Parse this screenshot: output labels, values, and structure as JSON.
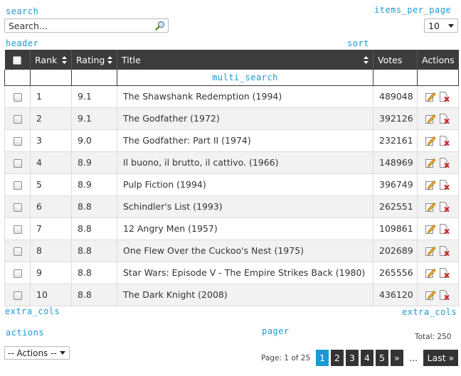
{
  "annotations": {
    "search": "search",
    "items_per_page": "items_per_page",
    "header": "header",
    "sort": "sort",
    "multi_search": "multi_search",
    "extra_cols_left": "extra_cols",
    "extra_cols_right": "extra_cols",
    "actions": "actions",
    "pager": "pager"
  },
  "search": {
    "placeholder": "Search...",
    "icon": "magnifier-icon"
  },
  "items_per_page": {
    "value": "10"
  },
  "columns": {
    "rank": "Rank",
    "rating": "Rating",
    "title": "Title",
    "votes": "Votes",
    "actions": "Actions"
  },
  "rows": [
    {
      "rank": "1",
      "rating": "9.1",
      "title": "The Shawshank Redemption (1994)",
      "votes": "489048"
    },
    {
      "rank": "2",
      "rating": "9.1",
      "title": "The Godfather (1972)",
      "votes": "392126"
    },
    {
      "rank": "3",
      "rating": "9.0",
      "title": "The Godfather: Part II (1974)",
      "votes": "232161"
    },
    {
      "rank": "4",
      "rating": "8.9",
      "title": "Il buono, il brutto, il cattivo. (1966)",
      "votes": "148969"
    },
    {
      "rank": "5",
      "rating": "8.9",
      "title": "Pulp Fiction (1994)",
      "votes": "396749"
    },
    {
      "rank": "6",
      "rating": "8.8",
      "title": "Schindler's List (1993)",
      "votes": "262551"
    },
    {
      "rank": "7",
      "rating": "8.8",
      "title": "12 Angry Men (1957)",
      "votes": "109861"
    },
    {
      "rank": "8",
      "rating": "8.8",
      "title": "One Flew Over the Cuckoo's Nest (1975)",
      "votes": "202689"
    },
    {
      "rank": "9",
      "rating": "8.8",
      "title": "Star Wars: Episode V - The Empire Strikes Back (1980)",
      "votes": "265556"
    },
    {
      "rank": "10",
      "rating": "8.8",
      "title": "The Dark Knight (2008)",
      "votes": "436120"
    }
  ],
  "row_action_icons": [
    "edit-icon",
    "delete-icon"
  ],
  "bulk_actions": {
    "selected": "-- Actions --"
  },
  "pager": {
    "page_label": "Page: 1 of 25",
    "total_label": "Total: 250",
    "pages": [
      "1",
      "2",
      "3",
      "4",
      "5"
    ],
    "current": "1",
    "next": "»",
    "ellipsis": "...",
    "last": "Last »"
  },
  "colors": {
    "annotation": "#1a9ad6",
    "header_bg": "#3c3c3c",
    "pager_bg": "#333333",
    "pager_active": "#1a9ad6",
    "row_alt": "#f2f2f2"
  }
}
